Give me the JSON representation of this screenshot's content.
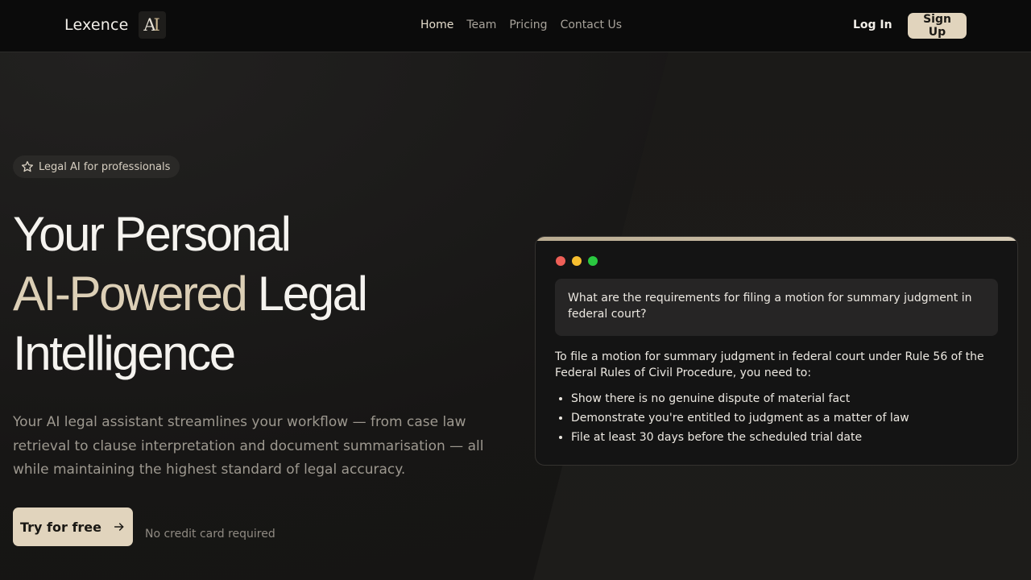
{
  "nav": {
    "brand": "Lexence",
    "links": [
      "Home",
      "Team",
      "Pricing",
      "Contact Us"
    ],
    "login": "Log In",
    "signup": "Sign Up"
  },
  "hero": {
    "badge": "Legal AI for professionals",
    "headline": {
      "line1": "Your Personal",
      "accent": "AI-Powered",
      "line2_rest": " Legal",
      "line3": "Intelligence"
    },
    "subtitle": "Your AI legal assistant streamlines your workflow — from case law retrieval to clause interpretation and document summarisation — all while maintaining the highest standard of legal accuracy.",
    "cta": "Try for free",
    "note": "No credit card required"
  },
  "chat": {
    "question": "What are the requirements for filing a motion for summary judgment in federal court?",
    "answer_intro": "To file a motion for summary judgment in federal court under Rule 56 of the Federal Rules of Civil Procedure, you need to:",
    "answer_points": [
      "Show there is no genuine dispute of material fact",
      "Demonstrate you're entitled to judgment as a matter of law",
      "File at least 30 days before the scheduled trial date"
    ]
  },
  "colors": {
    "accent": "#e1d4bd",
    "window_dot_red": "#ee5f57",
    "window_dot_yellow": "#f6be2f",
    "window_dot_green": "#2ac840"
  },
  "icons": {
    "badge": "star-icon",
    "cta": "arrow-right-icon"
  }
}
